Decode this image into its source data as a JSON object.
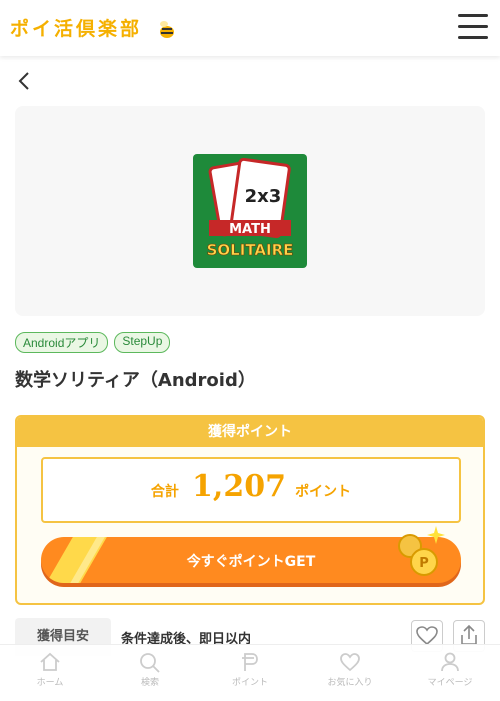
{
  "header": {
    "logo_text": "ポイ活倶楽部",
    "menu_icon": "hamburger-icon"
  },
  "nav": {
    "back_icon": "chevron-left-icon"
  },
  "app": {
    "icon_text_top": "2x3",
    "icon_text_mid": "MATH",
    "icon_text_bottom": "SOLITAIRE",
    "tags": [
      "Androidアプリ",
      "StepUp"
    ],
    "title": "数学ソリティア（Android）"
  },
  "points": {
    "header": "獲得ポイント",
    "total_label": "合計",
    "total_value": "1,207",
    "total_unit": "ポイント",
    "get_button": "今すぐポイントGET"
  },
  "eta": {
    "label": "獲得目安",
    "text": "条件達成後、即日以内"
  },
  "actions": {
    "favorite_icon": "heart-icon",
    "share_icon": "share-icon"
  },
  "bottom_nav": [
    {
      "label": "ホーム",
      "icon": "home-icon"
    },
    {
      "label": "検索",
      "icon": "search-icon"
    },
    {
      "label": "ポイント",
      "icon": "points-icon"
    },
    {
      "label": "お気に入り",
      "icon": "heart-icon"
    },
    {
      "label": "マイページ",
      "icon": "user-icon"
    }
  ],
  "colors": {
    "accent": "#f5c342",
    "button": "#ff8a1f",
    "tag_green": "#5cb85c"
  }
}
